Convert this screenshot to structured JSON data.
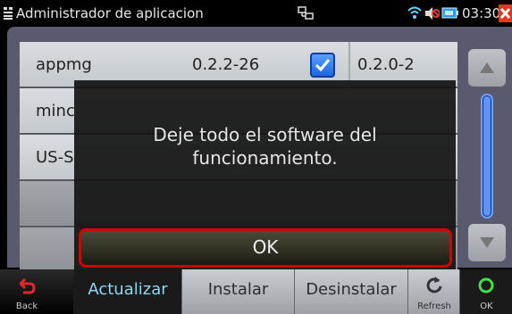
{
  "status_bar": {
    "title": "Administrador de aplicacion",
    "time": "03:30"
  },
  "package_list": {
    "rows": [
      {
        "name": "appmg",
        "version": "0.2.2-26",
        "checked": true,
        "new_version": "0.2.0-2"
      },
      {
        "name": "minc",
        "version": "",
        "checked": false,
        "new_version": ""
      },
      {
        "name": "US-S",
        "version": "",
        "checked": false,
        "new_version": ""
      },
      {
        "name": "",
        "version": "",
        "checked": false,
        "new_version": ""
      },
      {
        "name": "",
        "version": "",
        "checked": false,
        "new_version": ""
      }
    ]
  },
  "dialog": {
    "message_line1": "Deje todo el software del",
    "message_line2": "funcionamiento.",
    "ok_label": "OK"
  },
  "bottom_bar": {
    "back_label": "Back",
    "tabs": [
      "Actualizar",
      "Instalar",
      "Desinstalar"
    ],
    "active_tab": "Actualizar",
    "refresh_label": "Refresh",
    "ok_label": "OK"
  },
  "colors": {
    "accent": "#5d93ff",
    "dialog_ok_border": "#d40000",
    "close": "#e03a1e"
  }
}
